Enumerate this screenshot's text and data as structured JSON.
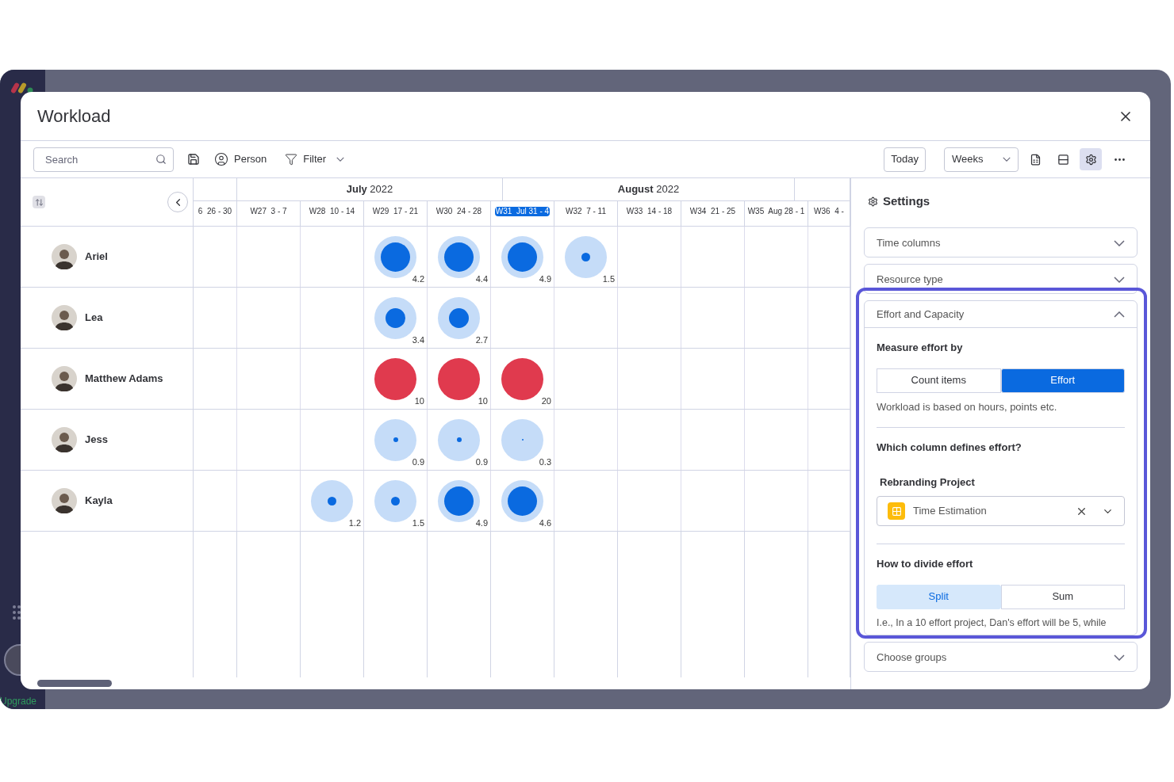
{
  "app": {
    "upgrade": "Upgrade"
  },
  "modal": {
    "title": "Workload",
    "toolbar": {
      "search": {
        "placeholder": "Search"
      },
      "person": "Person",
      "filter": "Filter",
      "today": "Today",
      "view": "Weeks",
      "settings_selected": true
    },
    "months": [
      {
        "label": "**July** 2022"
      },
      {
        "label": "**August** 2022"
      }
    ],
    "weeks": [
      {
        "week": "6",
        "dates": "26 - 30",
        "selected": false
      },
      {
        "week": "W27",
        "dates": "3 - 7",
        "selected": false
      },
      {
        "week": "W28",
        "dates": "10 - 14",
        "selected": false
      },
      {
        "week": "W29",
        "dates": "17 - 21",
        "selected": false
      },
      {
        "week": "W30",
        "dates": "24 - 28",
        "selected": false
      },
      {
        "week": "W31",
        "dates": "Jul 31 - 4",
        "selected": true
      },
      {
        "week": "W32",
        "dates": "7 - 11",
        "selected": false
      },
      {
        "week": "W33",
        "dates": "14 - 18",
        "selected": false
      },
      {
        "week": "W34",
        "dates": "21 - 25",
        "selected": false
      },
      {
        "week": "W35",
        "dates": "Aug 28 - 1",
        "selected": false
      },
      {
        "week": "W36",
        "dates": "4 -",
        "selected": false
      }
    ],
    "people": [
      {
        "name": "Ariel",
        "cells": [
          {
            "kind": "empty"
          },
          {
            "kind": "empty"
          },
          {
            "kind": "empty"
          },
          {
            "kind": "large",
            "value": "4.2"
          },
          {
            "kind": "large",
            "value": "4.4"
          },
          {
            "kind": "large",
            "value": "4.9"
          },
          {
            "kind": "small",
            "value": "1.5"
          },
          {
            "kind": "empty"
          },
          {
            "kind": "empty"
          },
          {
            "kind": "empty"
          },
          {
            "kind": "empty"
          }
        ]
      },
      {
        "name": "Lea",
        "cells": [
          {
            "kind": "empty"
          },
          {
            "kind": "empty"
          },
          {
            "kind": "empty"
          },
          {
            "kind": "medium",
            "value": "3.4"
          },
          {
            "kind": "medium",
            "value": "2.7"
          },
          {
            "kind": "empty"
          },
          {
            "kind": "empty"
          },
          {
            "kind": "empty"
          },
          {
            "kind": "empty"
          },
          {
            "kind": "empty"
          },
          {
            "kind": "empty"
          }
        ]
      },
      {
        "name": "Matthew Adams",
        "cells": [
          {
            "kind": "empty"
          },
          {
            "kind": "empty"
          },
          {
            "kind": "empty"
          },
          {
            "kind": "overload",
            "value": "10"
          },
          {
            "kind": "overload",
            "value": "10"
          },
          {
            "kind": "overload",
            "value": "20"
          },
          {
            "kind": "empty"
          },
          {
            "kind": "empty"
          },
          {
            "kind": "empty"
          },
          {
            "kind": "empty"
          },
          {
            "kind": "empty"
          }
        ]
      },
      {
        "name": "Jess",
        "cells": [
          {
            "kind": "empty"
          },
          {
            "kind": "empty"
          },
          {
            "kind": "empty"
          },
          {
            "kind": "tiny",
            "value": "0.9"
          },
          {
            "kind": "tiny",
            "value": "0.9"
          },
          {
            "kind": "trace",
            "value": "0.3"
          },
          {
            "kind": "empty"
          },
          {
            "kind": "empty"
          },
          {
            "kind": "empty"
          },
          {
            "kind": "empty"
          },
          {
            "kind": "empty"
          }
        ]
      },
      {
        "name": "Kayla",
        "cells": [
          {
            "kind": "empty"
          },
          {
            "kind": "empty"
          },
          {
            "kind": "small",
            "value": "1.2"
          },
          {
            "kind": "small",
            "value": "1.5"
          },
          {
            "kind": "large",
            "value": "4.9"
          },
          {
            "kind": "large",
            "value": "4.6"
          },
          {
            "kind": "empty"
          },
          {
            "kind": "empty"
          },
          {
            "kind": "empty"
          },
          {
            "kind": "empty"
          },
          {
            "kind": "empty"
          }
        ]
      }
    ],
    "settings": {
      "title": "Settings",
      "sections": [
        {
          "title": "Time columns",
          "expanded": false
        },
        {
          "title": "Resource type",
          "expanded": false
        },
        {
          "title": "Effort and Capacity",
          "expanded": true,
          "measure_label": "Measure effort by",
          "measure_options": {
            "options": [
              {
                "label": "Count items",
                "selected": false
              },
              {
                "label": "Effort",
                "selected": true
              }
            ]
          },
          "measure_hint": "Workload is based on hours, points etc.",
          "column_question": "Which column defines effort?",
          "board": "Rebranding Project",
          "column_select": "Time Estimation",
          "divide_label": "How to divide effort",
          "divide_options": {
            "options": [
              {
                "label": "Split",
                "selected": true
              },
              {
                "label": "Sum",
                "selected": false
              }
            ]
          },
          "divide_note": "I.e., In a 10 effort project, Dan's effort will be 5, while"
        },
        {
          "title": "Choose groups",
          "expanded": false
        }
      ]
    }
  }
}
